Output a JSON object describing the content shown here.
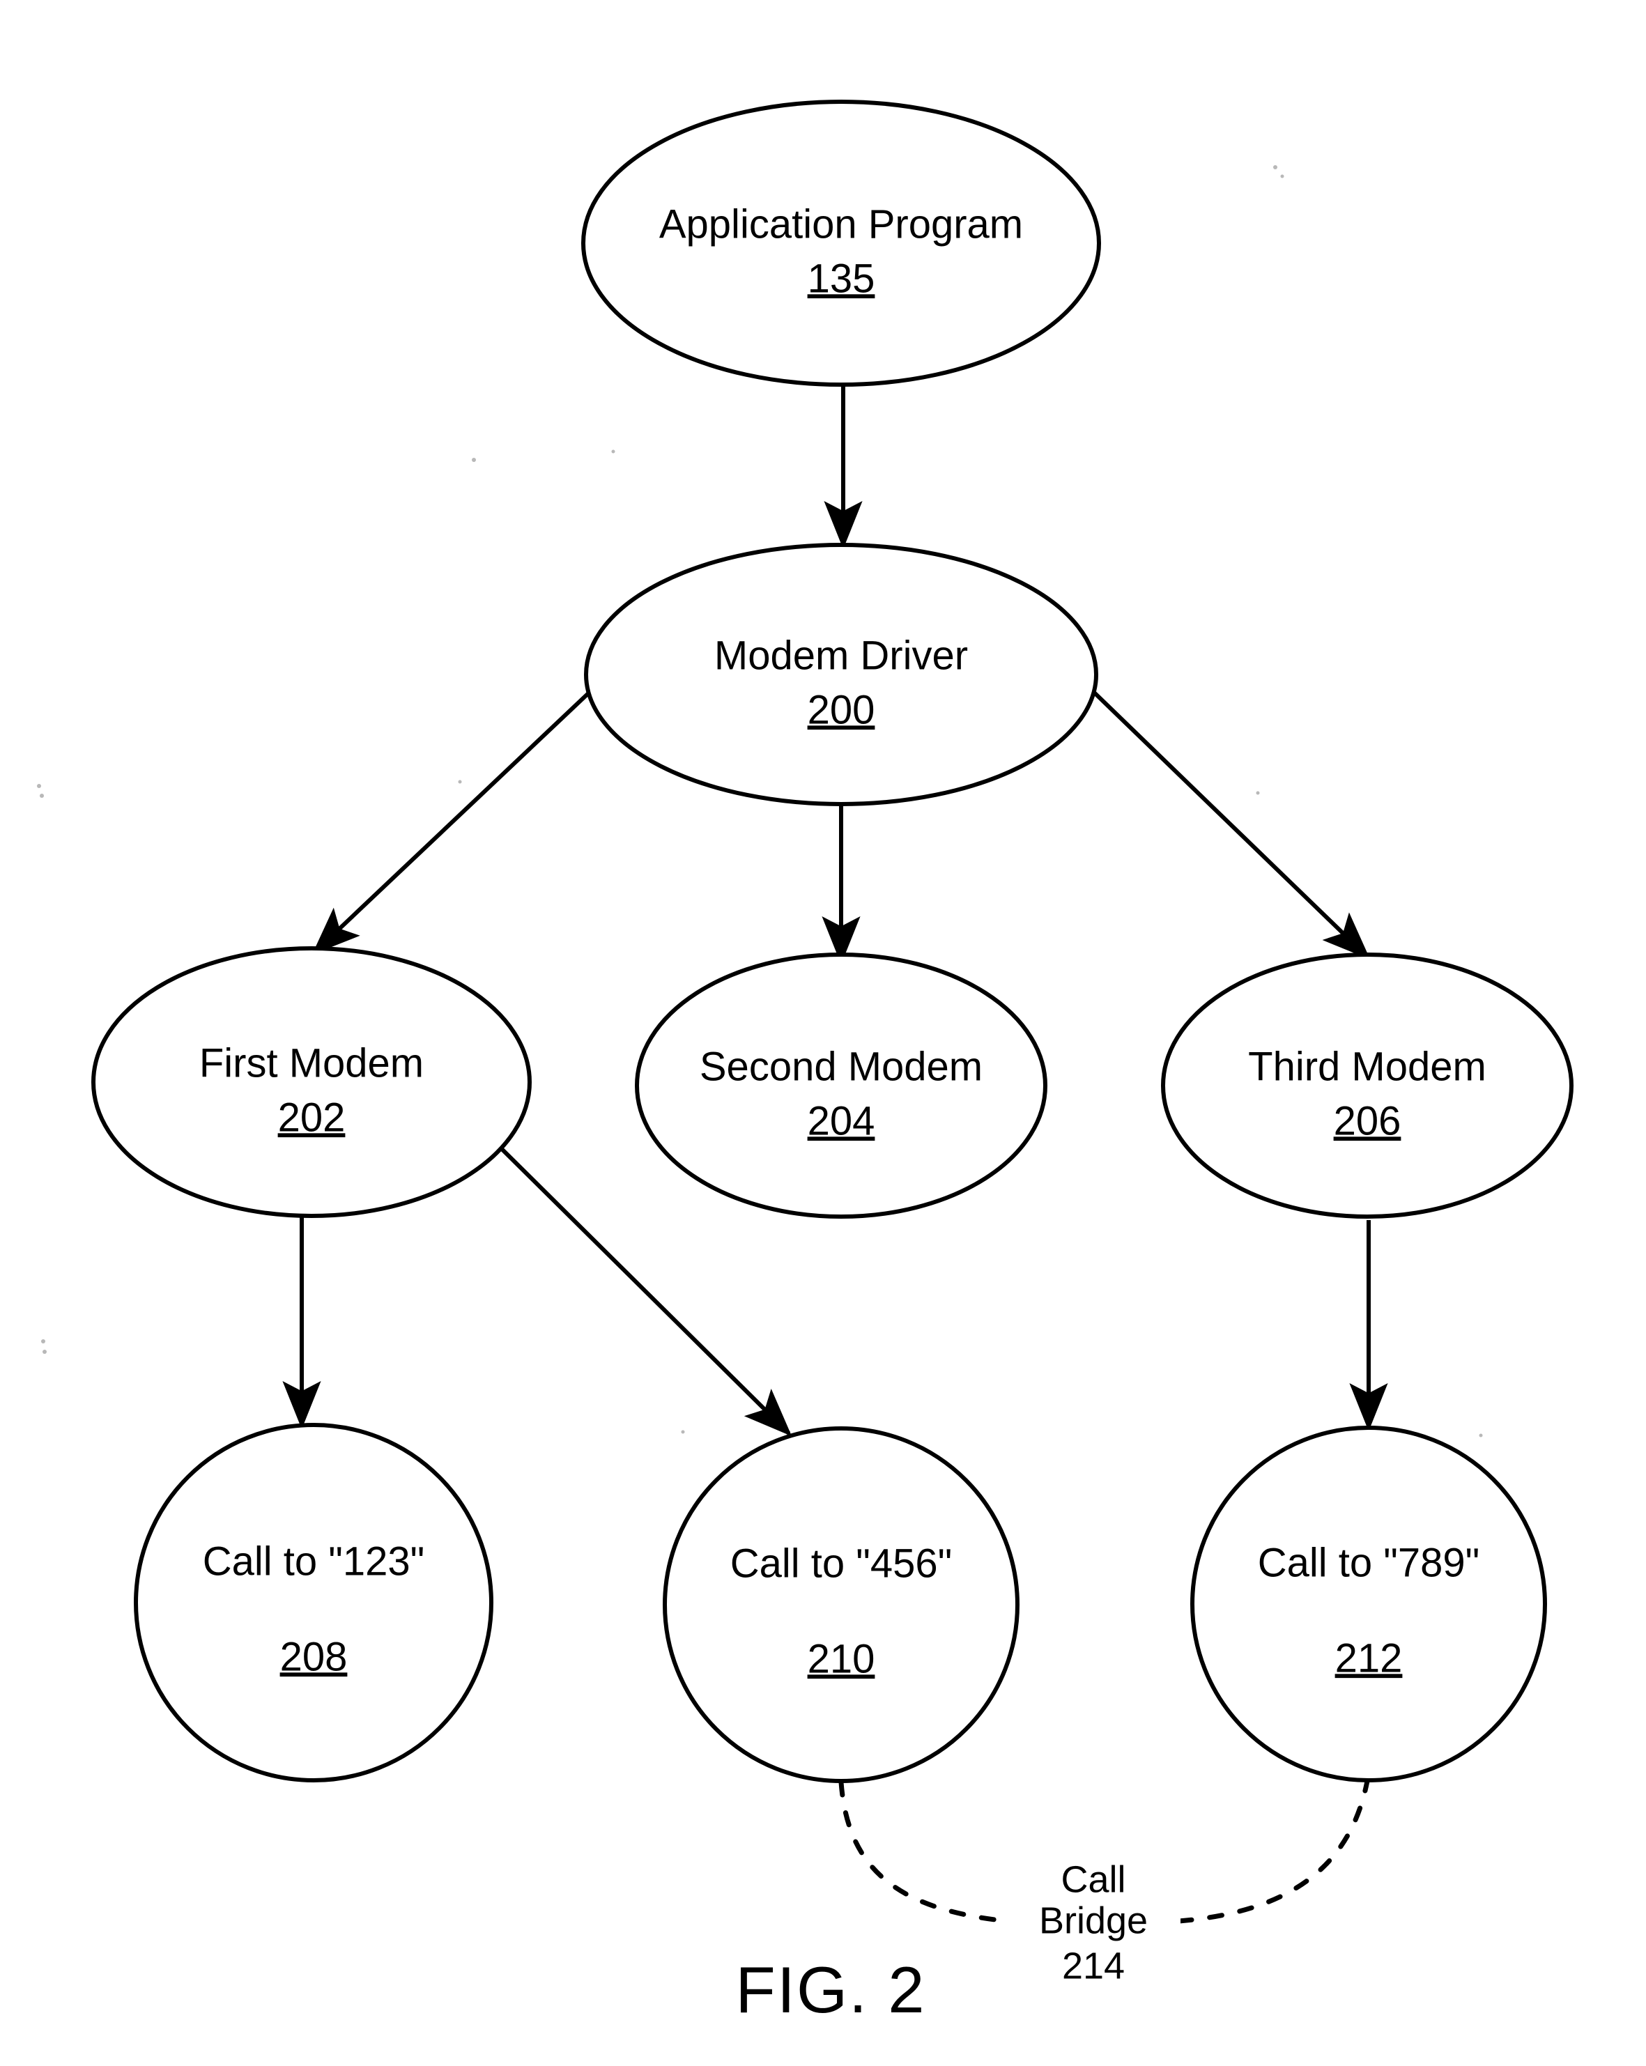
{
  "figure": {
    "caption": "FIG. 2",
    "nodes": [
      {
        "id": "application-program",
        "label": "Application Program",
        "ref": "135",
        "shape": "ellipse"
      },
      {
        "id": "modem-driver",
        "label": "Modem Driver",
        "ref": "200",
        "shape": "ellipse"
      },
      {
        "id": "first-modem",
        "label": "First Modem",
        "ref": "202",
        "shape": "ellipse"
      },
      {
        "id": "second-modem",
        "label": "Second Modem",
        "ref": "204",
        "shape": "ellipse"
      },
      {
        "id": "third-modem",
        "label": "Third Modem",
        "ref": "206",
        "shape": "ellipse"
      },
      {
        "id": "call-123",
        "label": "Call to \"123\"",
        "ref": "208",
        "shape": "circle"
      },
      {
        "id": "call-456",
        "label": "Call to \"456\"",
        "ref": "210",
        "shape": "circle"
      },
      {
        "id": "call-789",
        "label": "Call to \"789\"",
        "ref": "212",
        "shape": "circle"
      }
    ],
    "connectors": [
      {
        "id": "app-to-driver",
        "from": "application-program",
        "to": "modem-driver",
        "style": "solid-arrow"
      },
      {
        "id": "driver-to-first-modem",
        "from": "modem-driver",
        "to": "first-modem",
        "style": "solid-arrow"
      },
      {
        "id": "driver-to-second-modem",
        "from": "modem-driver",
        "to": "second-modem",
        "style": "solid-arrow"
      },
      {
        "id": "driver-to-third-modem",
        "from": "modem-driver",
        "to": "third-modem",
        "style": "solid-arrow"
      },
      {
        "id": "first-modem-to-call-123",
        "from": "first-modem",
        "to": "call-123",
        "style": "solid-arrow"
      },
      {
        "id": "first-modem-to-call-456",
        "from": "first-modem",
        "to": "call-456",
        "style": "solid-arrow"
      },
      {
        "id": "third-modem-to-call-789",
        "from": "third-modem",
        "to": "call-789",
        "style": "solid-arrow"
      },
      {
        "id": "call-bridge-link",
        "from": "call-456",
        "to": "call-789",
        "style": "dashed"
      }
    ],
    "call_bridge": {
      "line1": "Call",
      "line2": "Bridge",
      "ref": "214"
    },
    "colors": {
      "stroke": "#000000",
      "fill": "#ffffff",
      "background": "#ffffff"
    }
  }
}
